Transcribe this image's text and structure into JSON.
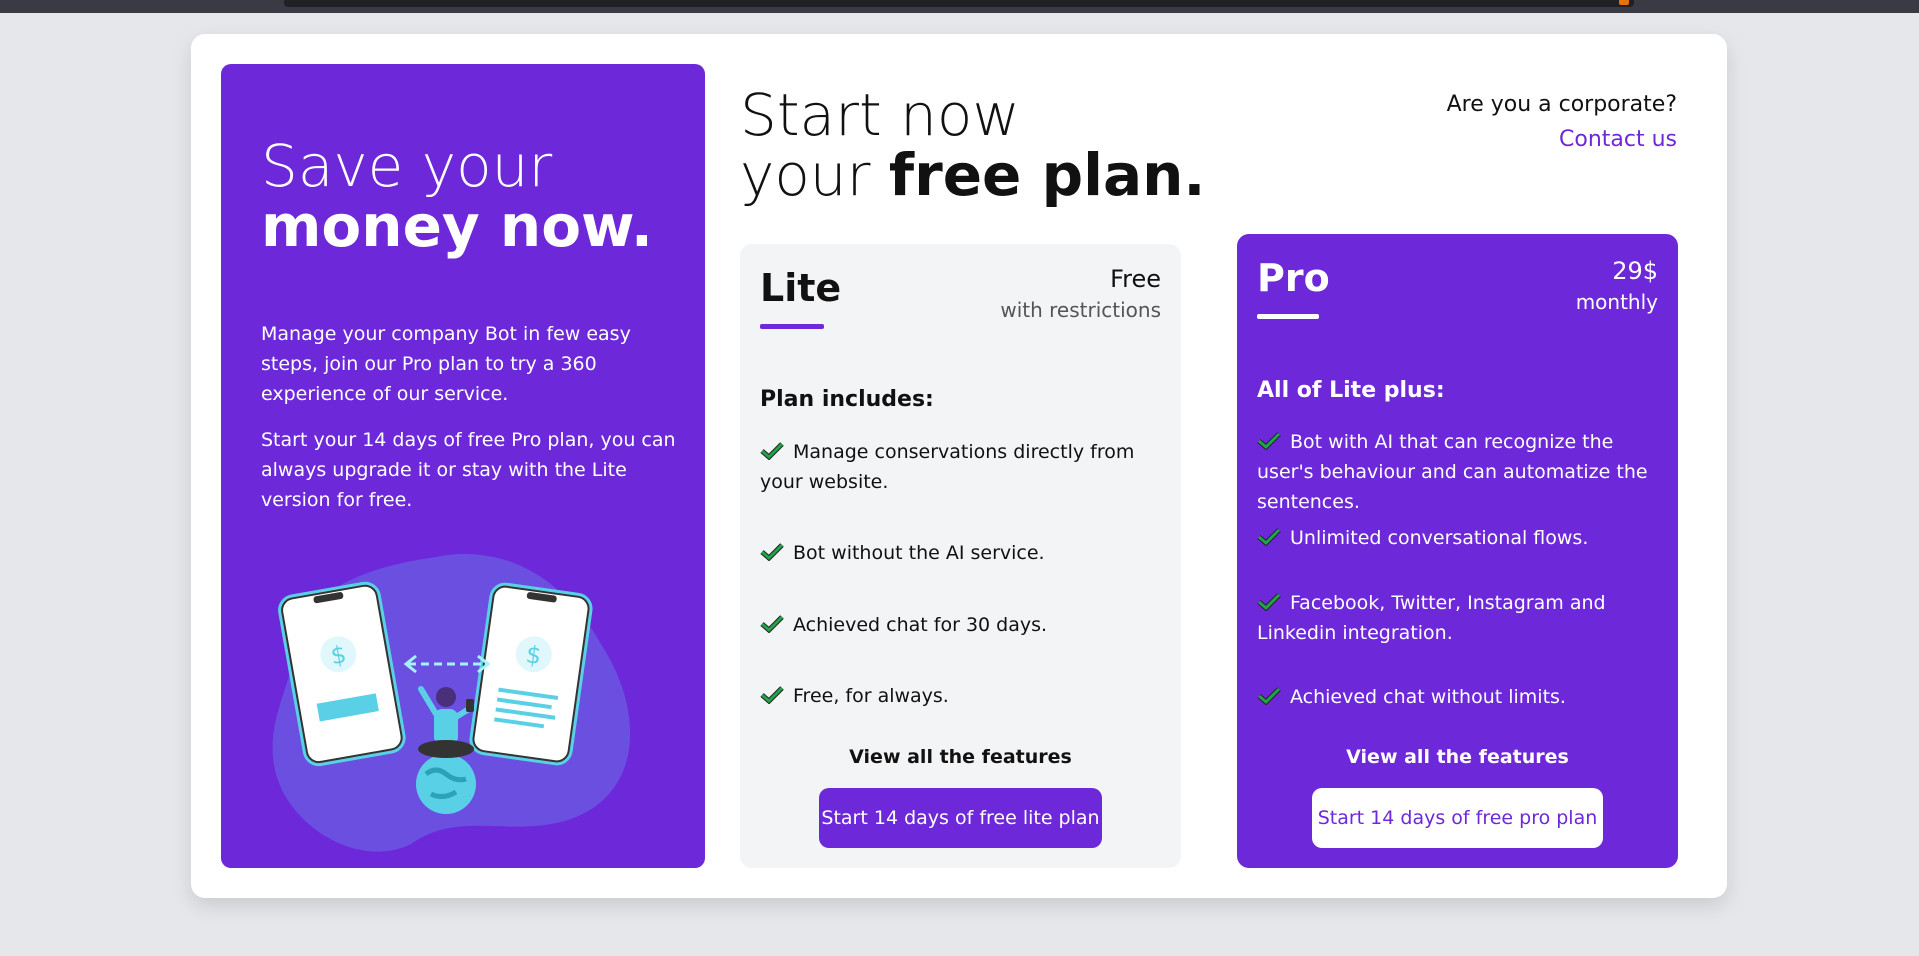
{
  "colors": {
    "accent": "#6d28d9",
    "light_card": "#f3f4f6",
    "check": "#15803d"
  },
  "promo": {
    "title_line1": "Save your",
    "title_line2": "money now.",
    "paragraph1": "Manage your company Bot in few easy steps, join our Pro plan to try a 360 experience of our service.",
    "paragraph2": "Start your 14 days of free Pro plan, you can always upgrade it or stay with the Lite version for free."
  },
  "heading": {
    "line1": "Start now",
    "line2_prefix": "your ",
    "line2_bold": "free plan."
  },
  "corporate": {
    "question": "Are you a corporate?",
    "link": "Contact us"
  },
  "lite": {
    "name": "Lite",
    "price": "Free",
    "price_note": "with restrictions",
    "includes_title": "Plan includes:",
    "features": [
      "Manage conservations directly from your website.",
      "Bot without the AI service.",
      "Achieved chat for 30 days.",
      "Free, for always."
    ],
    "view_all": "View all the features",
    "cta": "Start 14 days of free lite plan"
  },
  "pro": {
    "name": "Pro",
    "price": "29$",
    "price_note": "monthly",
    "includes_title": "All of Lite plus:",
    "features": [
      "Bot with AI that can recognize the user's behaviour and can automatize the sentences.",
      "Unlimited conversational flows.",
      "Facebook, Twitter, Instagram and Linkedin integration.",
      "Achieved chat without limits."
    ],
    "view_all": "View all the features",
    "cta": "Start 14 days of free pro plan"
  },
  "icons": [
    "check-icon",
    "dollar-icon",
    "globe-icon",
    "person-icon",
    "phone-icon",
    "arrow-icon"
  ]
}
